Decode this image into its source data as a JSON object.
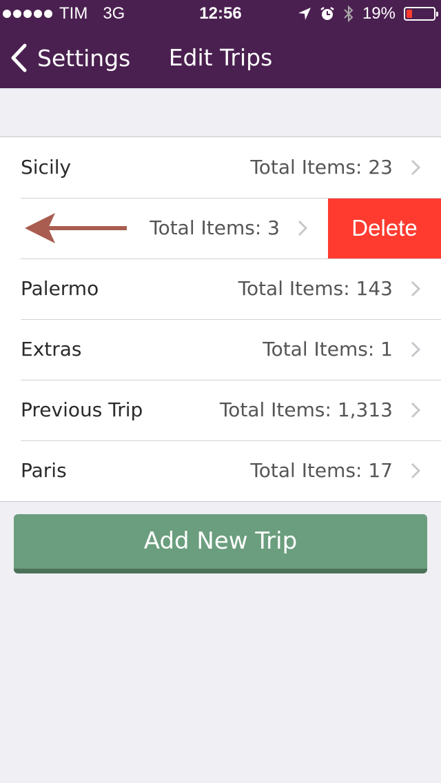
{
  "status_bar": {
    "carrier": "TIM",
    "network": "3G",
    "time": "12:56",
    "battery": "19%",
    "battery_level": 0.19
  },
  "nav": {
    "back_label": "Settings",
    "title": "Edit Trips"
  },
  "trips": [
    {
      "name": "Sicily",
      "total": "Total Items: 23"
    },
    {
      "name": "",
      "total": "Total Items: 3"
    },
    {
      "name": "Palermo",
      "total": "Total Items: 143"
    },
    {
      "name": "Extras",
      "total": "Total Items: 1"
    },
    {
      "name": "Previous Trip",
      "total": "Total Items: 1,313"
    },
    {
      "name": "Paris",
      "total": "Total Items: 17"
    }
  ],
  "delete_label": "Delete",
  "add_button_label": "Add New Trip",
  "colors": {
    "header": "#4a2050",
    "delete": "#ff3b30",
    "add_button": "#6b9e7e",
    "annotation_arrow": "#a85d50"
  }
}
